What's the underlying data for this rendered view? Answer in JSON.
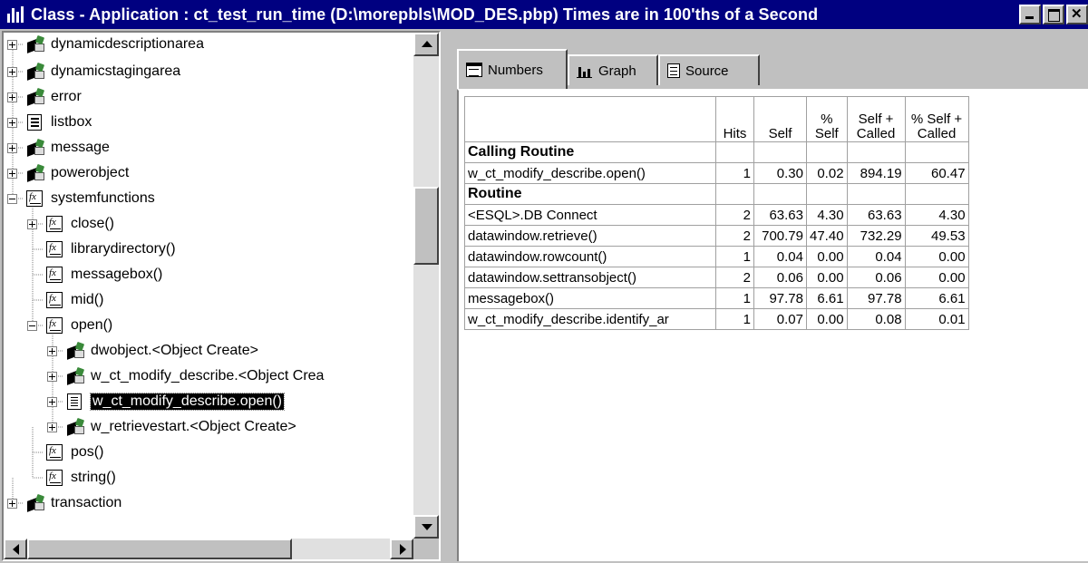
{
  "window": {
    "title": "Class - Application : ct_test_run_time (D:\\morepbls\\MOD_DES.pbp) Times are in 100'ths of a Second"
  },
  "tree": {
    "items": [
      {
        "label": "dynamicdescriptionarea",
        "icon": "object-icon",
        "expander": "plus"
      },
      {
        "label": "dynamicstagingarea",
        "icon": "object-icon",
        "expander": "plus"
      },
      {
        "label": "error",
        "icon": "object-icon",
        "expander": "plus"
      },
      {
        "label": "listbox",
        "icon": "listbox-icon",
        "expander": "plus"
      },
      {
        "label": "message",
        "icon": "object-icon",
        "expander": "plus"
      },
      {
        "label": "powerobject",
        "icon": "object-icon",
        "expander": "plus"
      },
      {
        "label": "systemfunctions",
        "icon": "function-icon",
        "expander": "minus"
      },
      {
        "label": "close()",
        "icon": "function-icon",
        "expander": "plus"
      },
      {
        "label": "librarydirectory()",
        "icon": "function-icon",
        "expander": "none"
      },
      {
        "label": "messagebox()",
        "icon": "function-icon",
        "expander": "none"
      },
      {
        "label": "mid()",
        "icon": "function-icon",
        "expander": "none"
      },
      {
        "label": "open()",
        "icon": "function-icon",
        "expander": "minus"
      },
      {
        "label": "dwobject.<Object Create>",
        "icon": "object-icon",
        "expander": "plus"
      },
      {
        "label": "w_ct_modify_describe.<Object Crea",
        "icon": "object-icon",
        "expander": "plus"
      },
      {
        "label": "w_ct_modify_describe.open()",
        "icon": "script-icon",
        "expander": "plus",
        "selected": true
      },
      {
        "label": "w_retrievestart.<Object Create>",
        "icon": "object-icon",
        "expander": "plus"
      },
      {
        "label": "pos()",
        "icon": "function-icon",
        "expander": "none"
      },
      {
        "label": "string()",
        "icon": "function-icon",
        "expander": "none"
      },
      {
        "label": "transaction",
        "icon": "object-icon",
        "expander": "plus"
      }
    ]
  },
  "tabs": [
    {
      "label": "Numbers",
      "icon": "numbers-icon",
      "active": true
    },
    {
      "label": "Graph",
      "icon": "graph-icon",
      "active": false
    },
    {
      "label": "Source",
      "icon": "source-icon",
      "active": false
    }
  ],
  "table": {
    "headers": [
      "",
      "Hits",
      "Self",
      "%\nSelf",
      "Self +\nCalled",
      "% Self +\nCalled"
    ],
    "sections": [
      {
        "title": "Calling Routine",
        "rows": [
          [
            "w_ct_modify_describe.open()",
            "1",
            "0.30",
            "0.02",
            "894.19",
            "60.47"
          ]
        ]
      },
      {
        "title": "Routine",
        "rows": [
          [
            "<ESQL>.DB Connect",
            "2",
            "63.63",
            "4.30",
            "63.63",
            "4.30"
          ],
          [
            "datawindow.retrieve()",
            "2",
            "700.79",
            "47.40",
            "732.29",
            "49.53"
          ],
          [
            "datawindow.rowcount()",
            "1",
            "0.04",
            "0.00",
            "0.04",
            "0.00"
          ],
          [
            "datawindow.settransobject()",
            "2",
            "0.06",
            "0.00",
            "0.06",
            "0.00"
          ],
          [
            "messagebox()",
            "1",
            "97.78",
            "6.61",
            "97.78",
            "6.61"
          ],
          [
            "w_ct_modify_describe.identify_ar",
            "1",
            "0.07",
            "0.00",
            "0.08",
            "0.01"
          ]
        ]
      }
    ]
  }
}
